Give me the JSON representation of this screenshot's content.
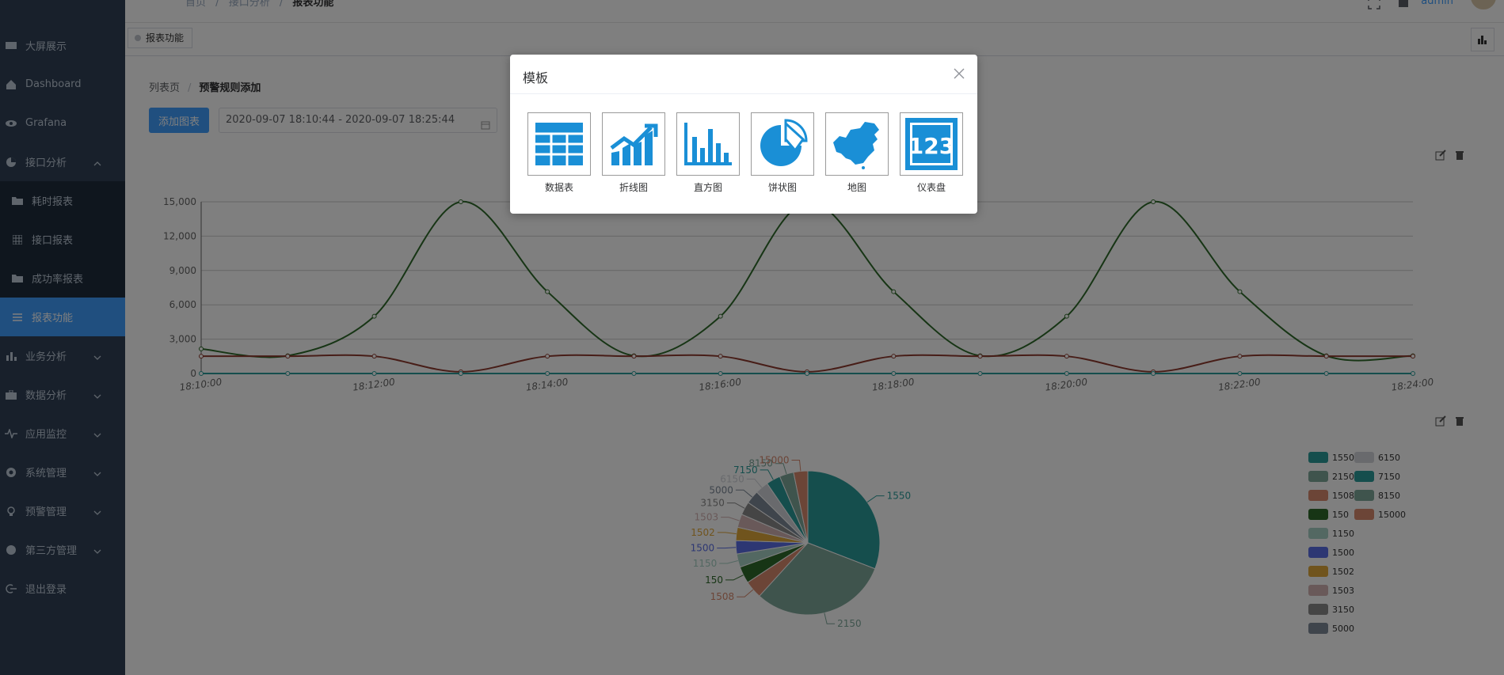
{
  "header": {
    "breadcrumb": [
      "首页",
      "接口分析",
      "报表功能"
    ],
    "user": "admin"
  },
  "sidebar": {
    "items": [
      {
        "label": "大屏展示",
        "icon": "monitor-icon"
      },
      {
        "label": "Dashboard",
        "icon": "home-icon"
      },
      {
        "label": "Grafana",
        "icon": "eye-icon"
      },
      {
        "label": "接口分析",
        "icon": "pie-icon",
        "expanded": true
      },
      {
        "label": "耗时报表",
        "icon": "folder-icon",
        "sub": true
      },
      {
        "label": "接口报表",
        "icon": "grid-icon",
        "sub": true
      },
      {
        "label": "成功率报表",
        "icon": "folder-icon",
        "sub": true
      },
      {
        "label": "报表功能",
        "icon": "list-icon",
        "sub": true,
        "active": true
      },
      {
        "label": "业务分析",
        "icon": "bar-icon"
      },
      {
        "label": "数据分析",
        "icon": "briefcase-icon"
      },
      {
        "label": "应用监控",
        "icon": "pulse-icon"
      },
      {
        "label": "系统管理",
        "icon": "gear-icon"
      },
      {
        "label": "预警管理",
        "icon": "bulb-icon"
      },
      {
        "label": "第三方管理",
        "icon": "circle-icon"
      },
      {
        "label": "退出登录",
        "icon": "logout-icon"
      }
    ]
  },
  "tags": {
    "current": "报表功能"
  },
  "page": {
    "crumb_list": "列表页",
    "crumb_current": "预警规则添加",
    "add_button": "添加图表",
    "date_range": "2020-09-07 18:10:44 - 2020-09-07 18:25:44"
  },
  "dialog": {
    "title": "模板",
    "templates": [
      {
        "label": "数据表",
        "icon": "table-icon"
      },
      {
        "label": "折线图",
        "icon": "line-chart-icon"
      },
      {
        "label": "直方图",
        "icon": "bar-chart-icon"
      },
      {
        "label": "饼状图",
        "icon": "pie-chart-icon"
      },
      {
        "label": "地图",
        "icon": "china-map-icon"
      },
      {
        "label": "仪表盘",
        "icon": "number-123-icon"
      }
    ]
  },
  "colors": {
    "primary": "#409eff",
    "sidebar": "#304156",
    "line_green": "#2f6b2a",
    "line_red": "#8f3a2f",
    "line_teal": "#2a9d9a"
  },
  "chart_data": [
    {
      "type": "line",
      "x": [
        "18:10:00",
        "18:11:00",
        "18:12:00",
        "18:13:00",
        "18:14:00",
        "18:15:00",
        "18:16:00",
        "18:17:00",
        "18:18:00",
        "18:19:00",
        "18:20:00",
        "18:21:00",
        "18:22:00",
        "18:23:00",
        "18:24:00"
      ],
      "xticks": [
        "18:10:00",
        "18:12:00",
        "18:14:00",
        "18:16:00",
        "18:18:00",
        "18:20:00",
        "18:22:00",
        "18:24:00"
      ],
      "yticks": [
        "0",
        "3,000",
        "6,000",
        "9,000",
        "12,000",
        "15,000"
      ],
      "ylim": [
        0,
        15000
      ],
      "grid": true,
      "series": [
        {
          "color": "#2f6b2a",
          "values": [
            2150,
            1550,
            5000,
            15000,
            7150,
            1550,
            5000,
            15000,
            7150,
            1550,
            5000,
            15000,
            7150,
            1550,
            1550
          ]
        },
        {
          "color": "#8f3a2f",
          "values": [
            1508,
            1508,
            1508,
            150,
            1508,
            1508,
            1508,
            150,
            1508,
            1508,
            1508,
            150,
            1508,
            1508,
            1508
          ]
        },
        {
          "color": "#2a9d9a",
          "values": [
            0,
            0,
            0,
            0,
            0,
            0,
            0,
            0,
            0,
            0,
            0,
            0,
            0,
            0,
            0
          ]
        }
      ]
    },
    {
      "type": "pie",
      "slices": [
        {
          "label": "1550",
          "value": 1550,
          "color": "#2a9d9a"
        },
        {
          "label": "2150",
          "value": 1550,
          "color": "#7fa89a"
        },
        {
          "label": "1508",
          "value": 200,
          "color": "#d98a6f"
        },
        {
          "label": "150",
          "value": 190,
          "color": "#2f6b2a"
        },
        {
          "label": "1150",
          "value": 150,
          "color": "#a6d0c5"
        },
        {
          "label": "1500",
          "value": 150,
          "color": "#5b6ee6"
        },
        {
          "label": "1502",
          "value": 150,
          "color": "#e0a83a"
        },
        {
          "label": "1503",
          "value": 150,
          "color": "#d3b3b3"
        },
        {
          "label": "3150",
          "value": 150,
          "color": "#8b8b8b"
        },
        {
          "label": "5000",
          "value": 150,
          "color": "#7e8a99"
        },
        {
          "label": "6150",
          "value": 150,
          "color": "#d2d5da"
        },
        {
          "label": "7150",
          "value": 160,
          "color": "#2a9d9a"
        },
        {
          "label": "8150",
          "value": 160,
          "color": "#7fa89a"
        },
        {
          "label": "15000",
          "value": 160,
          "color": "#d98a6f"
        }
      ],
      "legend": [
        "1550",
        "2150",
        "1508",
        "150",
        "1150",
        "1500",
        "1502",
        "1503",
        "3150",
        "5000",
        "6150",
        "7150",
        "8150",
        "15000"
      ],
      "legend_position": "right"
    }
  ]
}
